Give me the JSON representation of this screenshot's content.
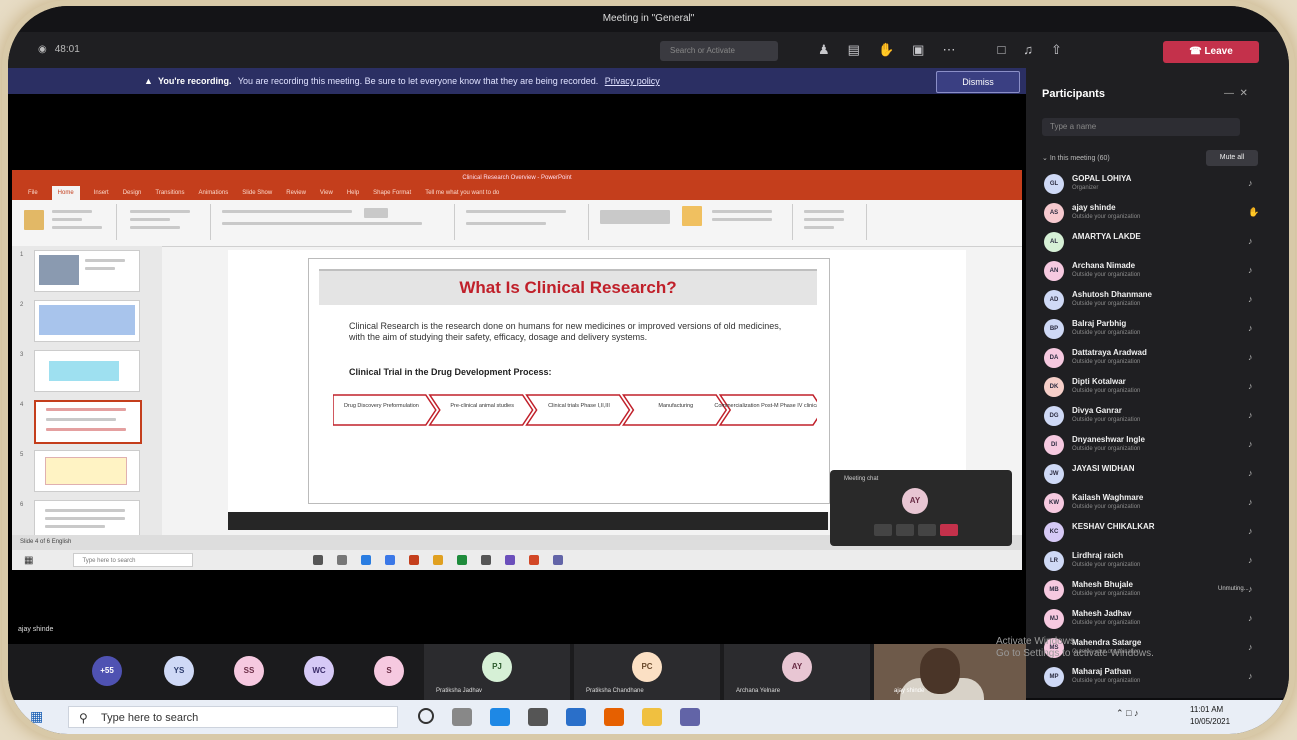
{
  "window": {
    "title": "Meeting in \"General\""
  },
  "toolbar": {
    "timer": "48:01",
    "chat_placeholder": "Search or Activate",
    "icons": [
      "people-icon",
      "chat-icon",
      "raise-hand-icon",
      "rooms-icon",
      "more-icon"
    ],
    "leave_label": "Leave"
  },
  "banner": {
    "strong": "You're recording.",
    "text": "You are recording this meeting. Be sure to let everyone know that they are being recorded.",
    "link": "Privacy policy",
    "dismiss": "Dismiss"
  },
  "ppt": {
    "title": "Clinical Research Overview - PowerPoint",
    "menu": [
      "File",
      "Home",
      "Insert",
      "Design",
      "Transitions",
      "Animations",
      "Slide Show",
      "Review",
      "View",
      "Help",
      "Shape Format",
      "Tell me what you want to do"
    ],
    "active_menu": "Home",
    "slide": {
      "heading": "What Is Clinical Research?",
      "body": "Clinical Research is the research done on humans for new medicines or improved versions of old medicines, with the aim of studying their safety, efficacy, dosage and delivery systems.",
      "subheading": "Clinical Trial in the Drug Development Process:",
      "steps": [
        "Drug Discovery Preformulation",
        "Pre-clinical animal studies",
        "Clinical trials Phase I,II,III",
        "Manufacturing",
        "Commercialization Post-M Phase IV clinical trial"
      ]
    },
    "inner_search": "Type here to search",
    "status": "Slide 4 of 6    English"
  },
  "meeting_popup": {
    "label": "Meeting chat",
    "initials": "AY"
  },
  "presenter_name": "ajay shinde",
  "panel": {
    "title": "Participants",
    "invite_placeholder": "Type a name",
    "in_meeting": "In this meeting (60)",
    "mute_all": "Mute all",
    "participants": [
      {
        "initials": "GL",
        "name": "GOPAL LOHIYA",
        "sub": "Organizer",
        "color": "#cfd9f6",
        "mic": "mic-off-icon"
      },
      {
        "initials": "AS",
        "name": "ajay shinde",
        "sub": "Outside your organization",
        "color": "#f6c9cf",
        "mic": "raise-hand-icon"
      },
      {
        "initials": "AL",
        "name": "AMARTYA LAKDE",
        "sub": "",
        "color": "#d6f0d6",
        "mic": "mic-off-icon"
      },
      {
        "initials": "AN",
        "name": "Archana Nimade",
        "sub": "Outside your organization",
        "color": "#f6c9e0",
        "mic": "mic-off-icon"
      },
      {
        "initials": "AD",
        "name": "Ashutosh Dhanmane",
        "sub": "Outside your organization",
        "color": "#cfd9f6",
        "mic": "mic-off-icon"
      },
      {
        "initials": "BP",
        "name": "Balraj Parbhig",
        "sub": "Outside your organization",
        "color": "#cfd9f6",
        "mic": "mic-off-icon"
      },
      {
        "initials": "DA",
        "name": "Dattatraya Aradwad",
        "sub": "Outside your organization",
        "color": "#f6c9e0",
        "mic": "mic-off-icon"
      },
      {
        "initials": "DK",
        "name": "Dipti Kotalwar",
        "sub": "Outside your organization",
        "color": "#f6cfc9",
        "mic": "mic-off-icon"
      },
      {
        "initials": "DG",
        "name": "Divya Ganrar",
        "sub": "Outside your organization",
        "color": "#cfd9f6",
        "mic": "mic-off-icon"
      },
      {
        "initials": "DI",
        "name": "Dnyaneshwar Ingle",
        "sub": "Outside your organization",
        "color": "#f6c9e0",
        "mic": "mic-off-icon"
      },
      {
        "initials": "JW",
        "name": "JAYASI WIDHAN",
        "sub": "",
        "color": "#cfd9f6",
        "mic": "mic-off-icon"
      },
      {
        "initials": "KW",
        "name": "Kailash Waghmare",
        "sub": "Outside your organization",
        "color": "#f6c9e0",
        "mic": "mic-off-icon"
      },
      {
        "initials": "KC",
        "name": "KESHAV CHIKALKAR",
        "sub": "",
        "color": "#d6c9f6",
        "mic": "mic-off-icon"
      },
      {
        "initials": "LR",
        "name": "Lirdhraj raich",
        "sub": "Outside your organization",
        "color": "#cfd9f6",
        "mic": "mic-off-icon"
      },
      {
        "initials": "MB",
        "name": "Mahesh Bhujale",
        "sub": "Outside your organization",
        "color": "#f6c9e0",
        "mic": "mic-off-icon",
        "status": "Unmuting..."
      },
      {
        "initials": "MJ",
        "name": "Mahesh Jadhav",
        "sub": "Outside your organization",
        "color": "#f6c9e0",
        "mic": "mic-off-icon"
      },
      {
        "initials": "MS",
        "name": "Mahendra Satarge",
        "sub": "Outside your organization",
        "color": "#f6c9e0",
        "mic": "mic-off-icon"
      },
      {
        "initials": "MP",
        "name": "Maharaj Pathan",
        "sub": "Outside your organization",
        "color": "#cfd9f6",
        "mic": "mic-off-icon"
      }
    ]
  },
  "gallery": {
    "bubbles": [
      {
        "initials": "+55",
        "color": "#4f52b2",
        "text": "#ffffff"
      },
      {
        "initials": "YS",
        "color": "#cfd9f6",
        "text": "#2b3a6b"
      },
      {
        "initials": "SS",
        "color": "#f6c9e0",
        "text": "#6a2c45"
      },
      {
        "initials": "WC",
        "color": "#d6c9f6",
        "text": "#3b2c6a"
      },
      {
        "initials": "S",
        "color": "#f6c9e0",
        "text": "#6a2c45"
      }
    ],
    "tiles": [
      {
        "initials": "PJ",
        "name": "Pratiksha Jadhav",
        "color": "#d6f0d6",
        "text": "#2c5a2c"
      },
      {
        "initials": "PC",
        "name": "Pratiksha Chandhane",
        "color": "#fbe0c4",
        "text": "#6a4a2c"
      },
      {
        "initials": "AY",
        "name": "Archana Yelnare",
        "color": "#e8c6d3",
        "text": "#6a2c45"
      }
    ],
    "video_name": "ajay shinde"
  },
  "watermark": [
    "Activate Windows",
    "Go to Settings to activate Windows."
  ],
  "taskbar": {
    "search_placeholder": "Type here to search",
    "time": "11:01 AM",
    "date": "10/05/2021"
  }
}
